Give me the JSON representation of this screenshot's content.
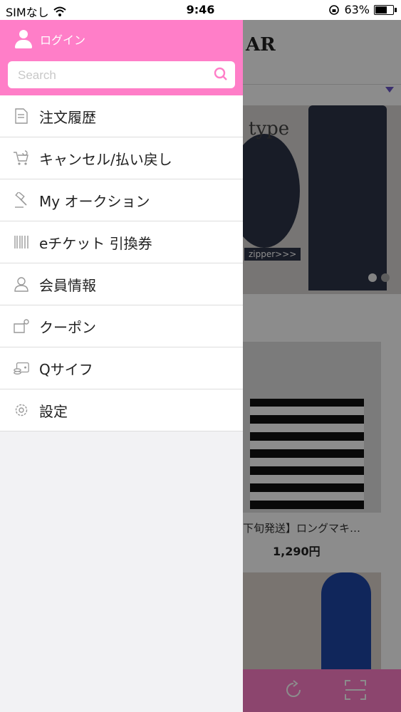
{
  "status_bar": {
    "carrier": "SIMなし",
    "time": "9:46",
    "battery": "63%",
    "battery_level": 0.63
  },
  "drawer": {
    "login_label": "ログイン",
    "search_placeholder": "Search",
    "items": [
      {
        "label": "注文履歴",
        "icon": "order-history-icon"
      },
      {
        "label": "キャンセル/払い戻し",
        "icon": "cart-refund-icon"
      },
      {
        "label": "My オークション",
        "icon": "auction-hammer-icon"
      },
      {
        "label": "eチケット 引換券",
        "icon": "barcode-icon"
      },
      {
        "label": "会員情報",
        "icon": "member-icon"
      },
      {
        "label": "クーポン",
        "icon": "coupon-icon"
      },
      {
        "label": "Qサイフ",
        "icon": "wallet-icon"
      },
      {
        "label": "設定",
        "icon": "gear-icon"
      }
    ]
  },
  "background_app": {
    "logo_fragment": "AR",
    "banner_text": "type",
    "banner_zip": "zipper>>>",
    "product_title": "下旬発送】ロングマキ…",
    "product_price": "1,290円"
  },
  "colors": {
    "accent_pink": "#ff7ec8",
    "dim_overlay": "rgba(0,0,0,0.45)"
  }
}
